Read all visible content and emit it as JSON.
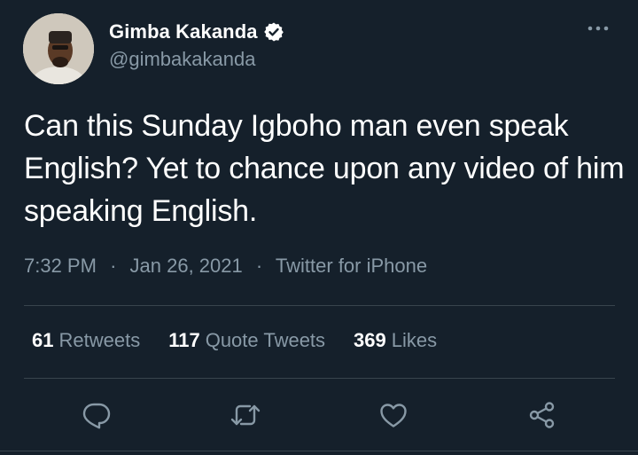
{
  "author": {
    "display_name": "Gimba Kakanda",
    "handle": "@gimbakakanda",
    "verified": true,
    "avatar_icon": "profile-photo"
  },
  "tweet": {
    "text": "Can this Sunday Igboho man even speak English? Yet to chance upon any video of him speaking English.",
    "time": "7:32 PM",
    "separator_1": "·",
    "date": "Jan 26, 2021",
    "separator_2": "·",
    "source": "Twitter for iPhone"
  },
  "stats": {
    "retweets_count": "61",
    "retweets_label": "Retweets",
    "quotes_count": "117",
    "quotes_label": "Quote Tweets",
    "likes_count": "369",
    "likes_label": "Likes"
  },
  "actions": [
    "reply-icon",
    "retweet-icon",
    "like-icon",
    "share-icon"
  ],
  "colors": {
    "background": "#15202b",
    "text": "#ffffff",
    "secondary": "#8899a6",
    "divider": "#38444d"
  }
}
